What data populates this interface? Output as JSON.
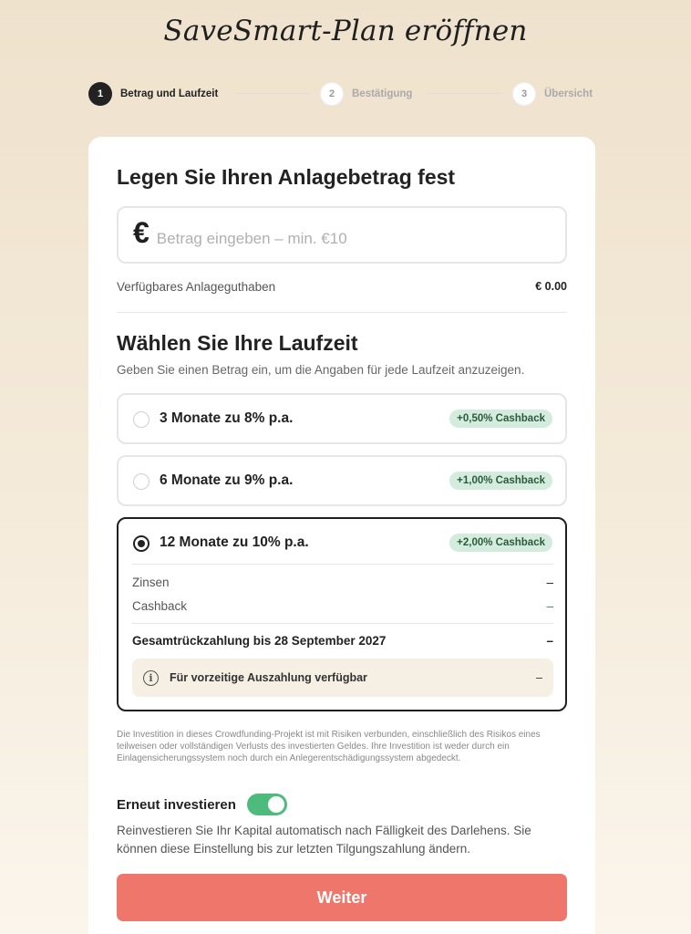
{
  "page": {
    "title": "SaveSmart-Plan eröffnen"
  },
  "stepper": {
    "steps": [
      {
        "number": "1",
        "label": "Betrag und Laufzeit",
        "state": "active"
      },
      {
        "number": "2",
        "label": "Bestätigung",
        "state": "inactive"
      },
      {
        "number": "3",
        "label": "Übersicht",
        "state": "inactive"
      }
    ]
  },
  "amount": {
    "heading": "Legen Sie Ihren Anlagebetrag fest",
    "currency_symbol": "€",
    "value": "",
    "placeholder": "Betrag eingeben – min. €10",
    "balance_label": "Verfügbares Anlageguthaben",
    "balance_value": "€ 0.00"
  },
  "term": {
    "heading": "Wählen Sie Ihre Laufzeit",
    "subtext": "Geben Sie einen Betrag ein, um die Angaben für jede Laufzeit anzuzeigen.",
    "options": [
      {
        "label": "3 Monate zu 8% p.a.",
        "cashback": "+0,50% Cashback",
        "selected": false
      },
      {
        "label": "6 Monate zu 9% p.a.",
        "cashback": "+1,00% Cashback",
        "selected": false
      },
      {
        "label": "12 Monate zu 10% p.a.",
        "cashback": "+2,00% Cashback",
        "selected": true
      }
    ],
    "details": {
      "interest_label": "Zinsen",
      "interest_value": "–",
      "cashback_label": "Cashback",
      "cashback_value": "–",
      "total_label": "Gesamtrückzahlung bis 28 September 2027",
      "total_value": "–",
      "info_icon_glyph": "i",
      "early_label": "Für vorzeitige Auszahlung verfügbar",
      "early_value": "–"
    }
  },
  "disclaimer": "Die Investition in dieses Crowdfunding-Projekt ist mit Risiken verbunden, einschließlich des Risikos eines teilweisen oder vollständigen Verlusts des investierten Geldes. Ihre Investition ist weder durch ein Einlagensicherungssystem noch durch ein Anlegerentschädigungssystem abgedeckt.",
  "reinvest": {
    "label": "Erneut investieren",
    "enabled": true,
    "description": "Reinvestieren Sie Ihr Kapital automatisch nach Fälligkeit des Darlehens. Sie können diese Einstellung bis zur letzten Tilgungszahlung ändern."
  },
  "actions": {
    "next_label": "Weiter"
  },
  "colors": {
    "accent_button": "#ef766a",
    "toggle_on": "#4dbb7c",
    "cashback_badge_bg": "#d3ecdd",
    "info_box_bg": "#f5efe4"
  }
}
